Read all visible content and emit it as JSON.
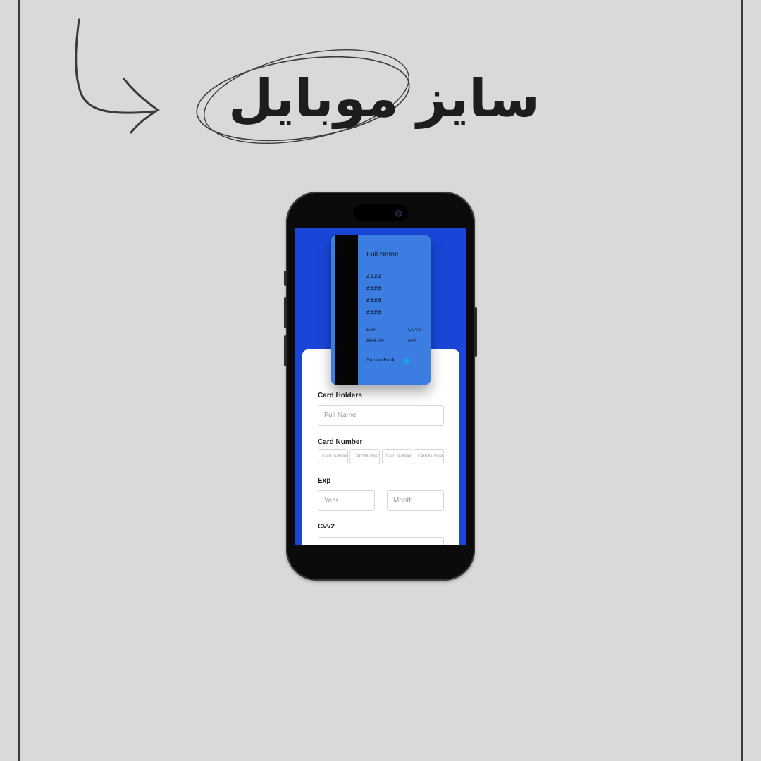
{
  "heading": {
    "text": "سایز موبایل"
  },
  "card_preview": {
    "name": "Full Name",
    "number_groups": [
      "####",
      "####",
      "####",
      "####"
    ],
    "exp_label": "EXP",
    "exp_value": "####/##",
    "cvv_label": "CVV2",
    "cvv_value": "###",
    "bank_name": "Saman Bank"
  },
  "form": {
    "card_holders_label": "Card Holders",
    "full_name_placeholder": "Full Name",
    "card_number_label": "Card Number",
    "card_number_placeholders": [
      "Card Number",
      "Card Number",
      "Card Number",
      "Card Number"
    ],
    "exp_label": "Exp",
    "year_placeholder": "Year",
    "month_placeholder": "Month",
    "cvv2_label": "Cvv2"
  },
  "colors": {
    "page_background": "#d9d9d9",
    "screen_background": "#1a46d8",
    "card_color": "#3b7de0",
    "heading_color": "#1d1d1d"
  }
}
